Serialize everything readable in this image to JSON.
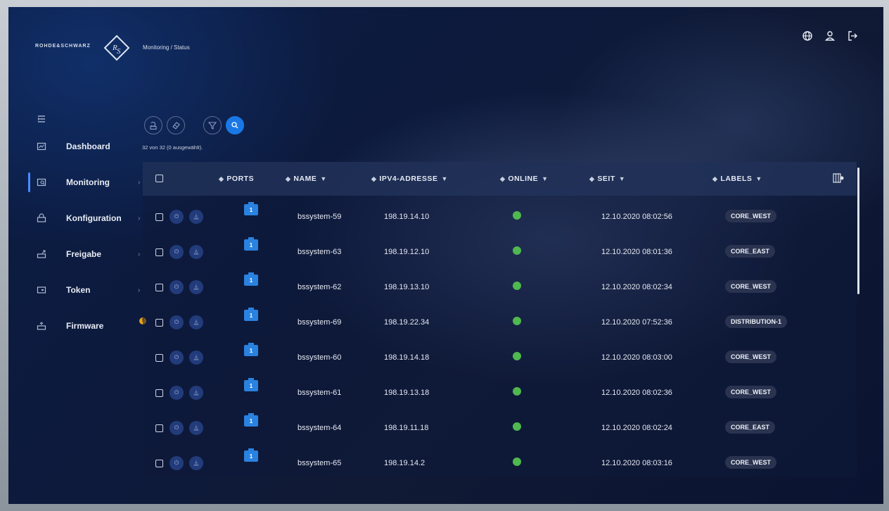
{
  "header": {
    "brand": "ROHDE&SCHWARZ",
    "breadcrumb": "Monitoring / Status",
    "icons": [
      "globe-icon",
      "user-icon",
      "logout-icon"
    ]
  },
  "sidebar": {
    "items": [
      {
        "label": "Dashboard",
        "icon": "dashboard-icon",
        "chevron": ""
      },
      {
        "label": "Monitoring",
        "icon": "monitoring-icon",
        "chevron": "›"
      },
      {
        "label": "Konfiguration",
        "icon": "configuration-icon",
        "chevron": "›"
      },
      {
        "label": "Freigabe",
        "icon": "share-icon",
        "chevron": "›"
      },
      {
        "label": "Token",
        "icon": "token-icon",
        "chevron": "›"
      },
      {
        "label": "Firmware",
        "icon": "firmware-icon",
        "chevron": "",
        "badge": "!"
      }
    ],
    "active": "Monitoring"
  },
  "toolbar": {
    "count_text": "32 von 32 (0 ausgewählt).",
    "buttons": [
      "refresh-device-icon",
      "erase-icon",
      "filter-icon",
      "search-icon"
    ]
  },
  "table": {
    "columns": {
      "ports": "PORTS",
      "name": "NAME",
      "ip": "IPV4-ADRESSE",
      "online": "ONLINE",
      "seit": "SEIT",
      "labels": "LABELS"
    },
    "rows": [
      {
        "port": "1",
        "name": "bssystem-59",
        "ip": "198.19.14.10",
        "online": true,
        "since": "12.10.2020 08:02:56",
        "label": "CORE_WEST"
      },
      {
        "port": "1",
        "name": "bssystem-63",
        "ip": "198.19.12.10",
        "online": true,
        "since": "12.10.2020 08:01:36",
        "label": "CORE_EAST"
      },
      {
        "port": "1",
        "name": "bssystem-62",
        "ip": "198.19.13.10",
        "online": true,
        "since": "12.10.2020 08:02:34",
        "label": "CORE_WEST"
      },
      {
        "port": "1",
        "name": "bssystem-69",
        "ip": "198.19.22.34",
        "online": true,
        "since": "12.10.2020 07:52:36",
        "label": "DISTRIBUTION-1"
      },
      {
        "port": "1",
        "name": "bssystem-60",
        "ip": "198.19.14.18",
        "online": true,
        "since": "12.10.2020 08:03:00",
        "label": "CORE_WEST"
      },
      {
        "port": "1",
        "name": "bssystem-61",
        "ip": "198.19.13.18",
        "online": true,
        "since": "12.10.2020 08:02:36",
        "label": "CORE_WEST"
      },
      {
        "port": "1",
        "name": "bssystem-64",
        "ip": "198.19.11.18",
        "online": true,
        "since": "12.10.2020 08:02:24",
        "label": "CORE_EAST"
      },
      {
        "port": "1",
        "name": "bssystem-65",
        "ip": "198.19.14.2",
        "online": true,
        "since": "12.10.2020 08:03:16",
        "label": "CORE_WEST"
      }
    ]
  },
  "colors": {
    "accent": "#1a78e6",
    "online": "#4fb84f",
    "badge": "#e5a317"
  }
}
